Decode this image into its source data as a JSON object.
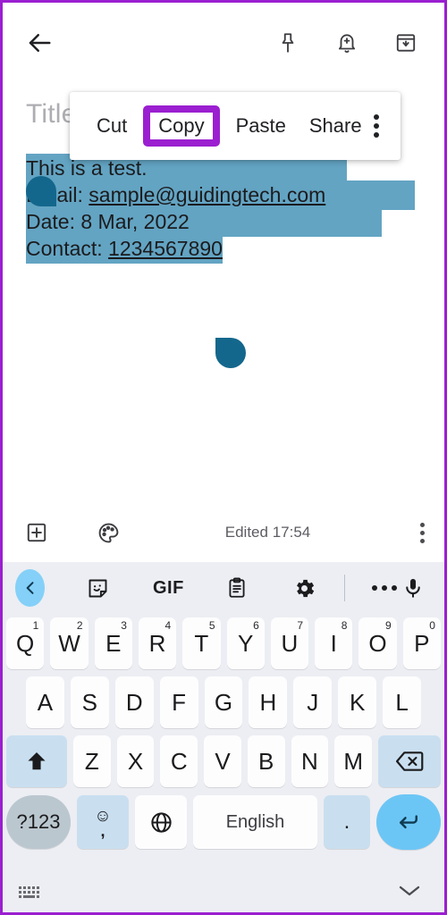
{
  "theme": {
    "frame_border": "#9b1fd0",
    "selection_highlight": "#63a4c3",
    "selection_handle": "#14678c",
    "highlight_box": "#9b1fd0",
    "keyboard_bg": "#eceef3",
    "key_bg": "#fdfdfe",
    "mod_key_bg": "#c9dff0",
    "enter_key_bg": "#6cc6f5",
    "sym_key_bg": "#bbc7cf",
    "toolbar_back_bg": "#84d0f8"
  },
  "appbar": {
    "back": "back-arrow-icon",
    "actions": [
      {
        "name": "pin-icon",
        "label": "Pin"
      },
      {
        "name": "reminder-bell-icon",
        "label": "Reminder"
      },
      {
        "name": "archive-icon",
        "label": "Archive"
      }
    ]
  },
  "note": {
    "title_placeholder": "Title",
    "lines": [
      {
        "text": "This is a test.",
        "selected": true,
        "link": false
      },
      {
        "prefix": "Email: ",
        "link_text": "sample@guidingtech.com",
        "selected": true,
        "link": true
      },
      {
        "text": "Date: 8 Mar, 2022",
        "selected": true,
        "link": false
      },
      {
        "prefix": "Contact: ",
        "link_text": "1234567890",
        "selected": true,
        "link": true
      }
    ],
    "selection_handles": {
      "start": "selection-handle-start",
      "end": "selection-handle-end"
    }
  },
  "context_menu": {
    "items": [
      {
        "label": "Cut",
        "highlighted": false
      },
      {
        "label": "Copy",
        "highlighted": true
      },
      {
        "label": "Paste",
        "highlighted": false
      },
      {
        "label": "Share",
        "highlighted": false
      }
    ],
    "overflow": "more-options-icon"
  },
  "note_bottom_bar": {
    "add_label": "add-box-icon",
    "palette_label": "color-palette-icon",
    "edited_text": "Edited 17:54",
    "overflow": "more-options-icon"
  },
  "keyboard": {
    "toolbar": [
      {
        "name": "back-chevron-icon",
        "label": "",
        "active": true
      },
      {
        "name": "sticker-icon",
        "label": ""
      },
      {
        "name": "gif-icon",
        "label": "GIF"
      },
      {
        "name": "clipboard-icon",
        "label": ""
      },
      {
        "name": "settings-gear-icon",
        "label": ""
      },
      {
        "name": "more-dots-icon",
        "label": ""
      },
      {
        "name": "microphone-icon",
        "label": ""
      }
    ],
    "row1": [
      {
        "key": "Q",
        "sup": "1"
      },
      {
        "key": "W",
        "sup": "2"
      },
      {
        "key": "E",
        "sup": "3"
      },
      {
        "key": "R",
        "sup": "4"
      },
      {
        "key": "T",
        "sup": "5"
      },
      {
        "key": "Y",
        "sup": "6"
      },
      {
        "key": "U",
        "sup": "7"
      },
      {
        "key": "I",
        "sup": "8"
      },
      {
        "key": "O",
        "sup": "9"
      },
      {
        "key": "P",
        "sup": "0"
      }
    ],
    "row2": [
      {
        "key": "A"
      },
      {
        "key": "S"
      },
      {
        "key": "D"
      },
      {
        "key": "F"
      },
      {
        "key": "G"
      },
      {
        "key": "H"
      },
      {
        "key": "J"
      },
      {
        "key": "K"
      },
      {
        "key": "L"
      }
    ],
    "row3": [
      {
        "key": "Z"
      },
      {
        "key": "X"
      },
      {
        "key": "C"
      },
      {
        "key": "V"
      },
      {
        "key": "B"
      },
      {
        "key": "N"
      },
      {
        "key": "M"
      }
    ],
    "shift_key": "shift-key-icon",
    "backspace_key": "backspace-key-icon",
    "row4": {
      "symbols_label": "?123",
      "emoji_label": "emoji-comma-key",
      "comma_label": ",",
      "globe_label": "language-globe-icon",
      "space_label": "English",
      "period_label": ".",
      "enter_label": "enter-key-icon"
    },
    "navbar": {
      "keyboard_icon": "keyboard-switch-icon",
      "hide_icon": "hide-keyboard-chevron-icon"
    }
  }
}
